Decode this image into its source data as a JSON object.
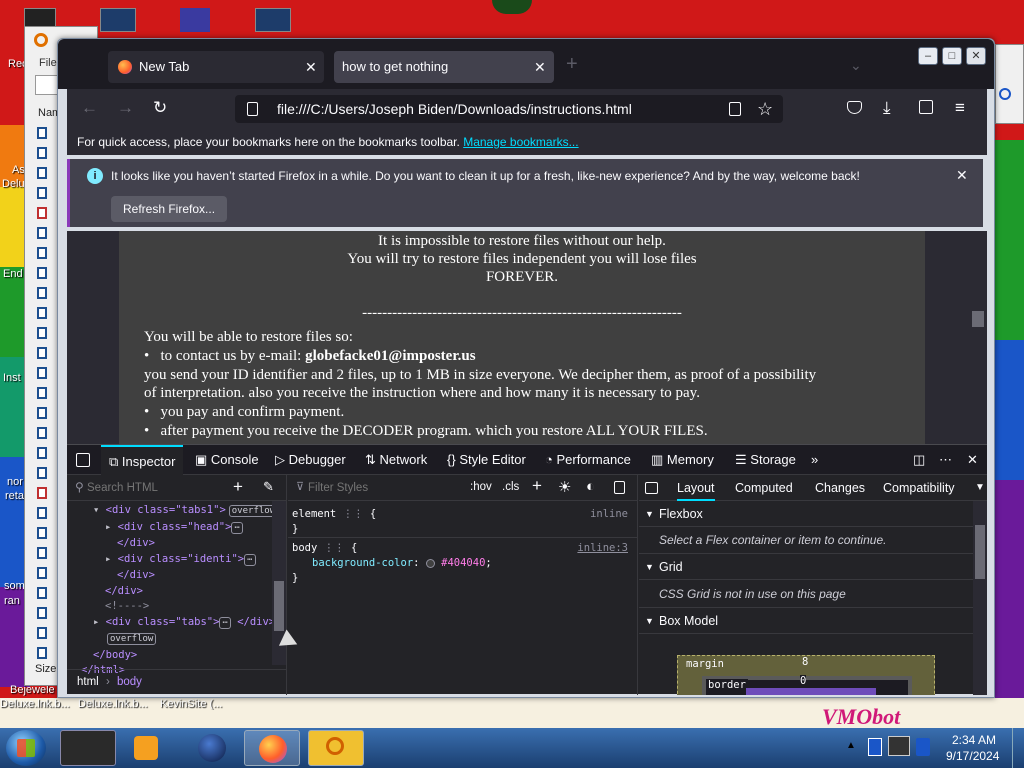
{
  "desktop": {
    "labels": [
      "Rec",
      "As",
      "Delu",
      "End",
      "Inst",
      "nor",
      "reta",
      "som",
      "ran",
      "Bejewele",
      "Deluxe.lnk.b...",
      "Deluxe.lnk.b...",
      "KevinSite (..."
    ],
    "explorer_labels": [
      "File",
      "Nam",
      "Size:"
    ],
    "wallpaper_text": "VMObot"
  },
  "tabs": [
    {
      "label": "New Tab"
    },
    {
      "label": "how to get nothing"
    }
  ],
  "url": "file:///C:/Users/Joseph Biden/Downloads/instructions.html",
  "bookmarks": {
    "text": "For quick access, place your bookmarks here on the bookmarks toolbar.",
    "link": "Manage bookmarks..."
  },
  "notification": {
    "text": "It looks like you haven’t started Firefox in a while. Do you want to clean it up for a fresh, like-new experience? And by the way, welcome back!",
    "button": "Refresh Firefox..."
  },
  "page": {
    "line1": "It is impossible to restore files without our help.",
    "line2": "You will try to restore files independent you will lose files",
    "line3": "FOREVER.",
    "divider": "----------------------------------------------------------------",
    "intro": "You will be able to restore files so:",
    "bullet1_pre": "to contact us by e-mail: ",
    "bullet1_email": "globefacke01@imposter.us",
    "para": "you send your ID identifier and 2 files, up to 1 MB in size everyone. We decipher them, as proof of a possibility of interpretation. also you receive the instruction where and how many it is necessary to pay.",
    "bullet2": "you pay and confirm payment.",
    "bullet3": "after payment you receive the DECODER program. which you restore ALL YOUR FILES."
  },
  "devtools": {
    "tabs": [
      "Inspector",
      "Console",
      "Debugger",
      "Network",
      "Style Editor",
      "Performance",
      "Memory",
      "Storage"
    ],
    "search_placeholder": "Search HTML",
    "html_lines": [
      "<div class=\"tabs1\">",
      "<div class=\"head\">",
      "</div>",
      "<div class=\"identi\">",
      "</div>",
      "</div>",
      "<!---->",
      "<div class=\"tabs\">",
      "</body>",
      "</html>"
    ],
    "overflow_badge": "overflow",
    "breadcrumb": [
      "html",
      "body"
    ],
    "filter_placeholder": "Filter Styles",
    "hov": ":hov",
    "cls": ".cls",
    "rule1_selector": "element",
    "rule1_source": "inline",
    "rule2_selector": "body",
    "rule2_source": "inline:3",
    "rule2_prop": "background-color",
    "rule2_value": "#404040",
    "layout_tabs": [
      "Layout",
      "Computed",
      "Changes",
      "Compatibility"
    ],
    "flexbox_title": "Flexbox",
    "flexbox_msg": "Select a Flex container or item to continue.",
    "grid_title": "Grid",
    "grid_msg": "CSS Grid is not in use on this page",
    "boxmodel_title": "Box Model",
    "margin_label": "margin",
    "margin_value": "8",
    "border_label": "border",
    "border_value": "0"
  },
  "taskbar": {
    "time": "2:34 AM",
    "date": "9/17/2024"
  }
}
